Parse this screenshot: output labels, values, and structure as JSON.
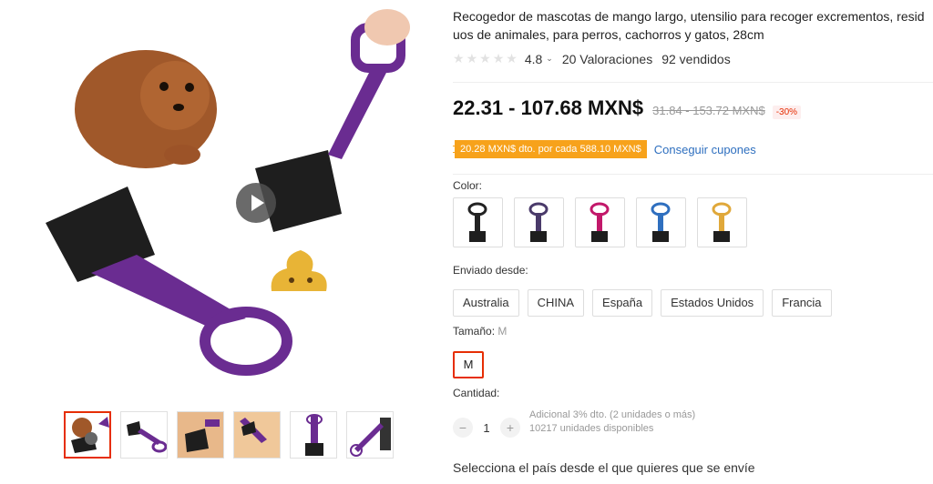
{
  "gallery": {
    "play_icon": "play-icon",
    "thumbnail_count": 6
  },
  "product": {
    "title": "Recogedor de mascotas de mango largo, utensilio para recoger excrementos, residuos de animales, para perros, cachorros y gatos, 28cm",
    "rating": "4.8",
    "reviews": "20 Valoraciones",
    "sold": "92 vendidos",
    "price": "22.31 - 107.68 MXN$",
    "old_price": "31.84 - 153.72 MXN$",
    "discount": "-30%",
    "coupon": "20.28 MXN$ dto. por cada 588.10 MXN$",
    "coupon_link": "Conseguir cupones"
  },
  "color": {
    "label": "Color:",
    "options": [
      "#222222",
      "#4a3a6a",
      "#c2186a",
      "#2f6fbf",
      "#e0a83a"
    ]
  },
  "ship_from": {
    "label": "Enviado desde:",
    "options": [
      "Australia",
      "CHINA",
      "España",
      "Estados Unidos",
      "Francia"
    ]
  },
  "size": {
    "label": "Tamaño:",
    "selected": "M",
    "option": "M"
  },
  "quantity": {
    "label": "Cantidad:",
    "value": "1",
    "minus": "−",
    "plus": "+",
    "discount_note": "Adicional 3% dto. (2 unidades o más)",
    "stock": "10217 unidades disponibles"
  },
  "ship_note": "Selecciona el país desde el que quieres que se envíe",
  "colors": {
    "accent": "#e62e04",
    "purple": "#6a2c91",
    "coupon": "#f7a21b",
    "link": "#2e6fbf"
  }
}
